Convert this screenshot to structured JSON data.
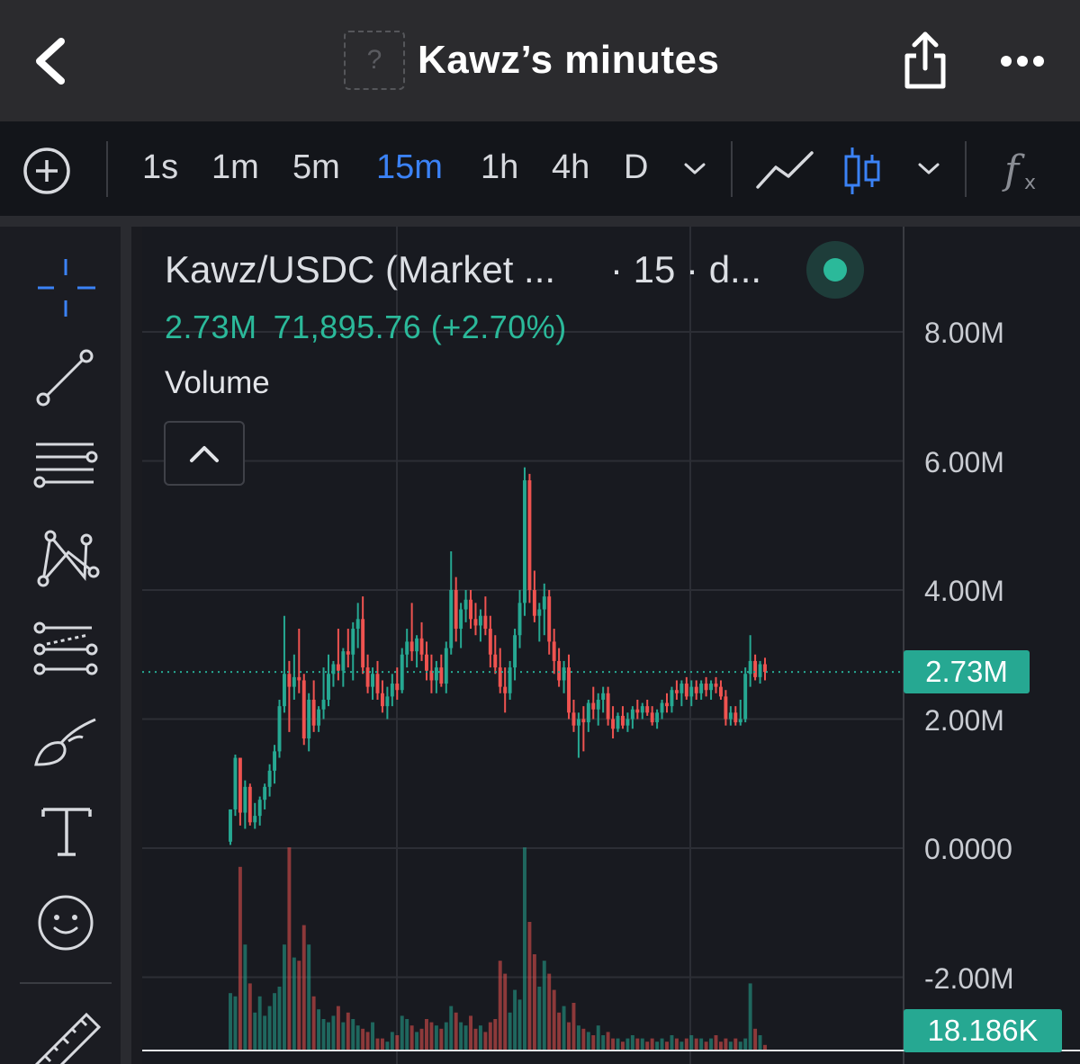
{
  "header": {
    "title": "Kawz’s minutes",
    "token_icon_glyph": "?",
    "back_icon": "chevron-left-icon",
    "share_icon": "share-icon",
    "more_icon": "more-horizontal-icon"
  },
  "toolbar": {
    "add_icon": "plus-circle-icon",
    "timeframes": [
      "1s",
      "1m",
      "5m",
      "15m",
      "1h",
      "4h",
      "D"
    ],
    "active_timeframe": "15m",
    "timeframe_dropdown_icon": "chevron-down-icon",
    "line_chart_icon": "line-chart-icon",
    "candle_chart_icon": "candlestick-icon",
    "chart_type_dropdown_icon": "chevron-down-icon",
    "indicators_icon": "function-icon"
  },
  "tools_rail": [
    "crosshair-icon",
    "trend-line-icon",
    "horizontal-lines-icon",
    "pattern-icon",
    "fib-tools-icon",
    "brush-icon",
    "text-icon",
    "emoji-icon",
    "ruler-icon"
  ],
  "legend": {
    "symbol": "Kawz/USDC (Market ...",
    "interval": "· 15 · d...",
    "status": "online",
    "last_value": "2.73M",
    "change": "71,895.76 (+2.70%)",
    "study_name": "Volume"
  },
  "price_axis": {
    "labels": [
      "8.00M",
      "6.00M",
      "4.00M",
      "2.00M",
      "0.0000",
      "-2.00M"
    ],
    "current_price_tag": "2.73M",
    "volume_tag": "18.186K"
  },
  "colors": {
    "up": "#26a892",
    "down": "#ef5350",
    "accent_blue": "#3b82f6",
    "background": "#181a20"
  },
  "chart_data": {
    "type": "candlestick",
    "interval": "15m",
    "y_unit": "market cap (USDC)",
    "ylim": [
      -2.6,
      9.0
    ],
    "last_price": 2.73,
    "series": [
      {
        "name": "Kawz/USDC (Market ...",
        "values": [
          [
            0.1,
            0.6,
            0.05,
            0.6
          ],
          [
            0.6,
            1.45,
            0.5,
            1.4
          ],
          [
            1.4,
            1.4,
            0.35,
            0.55
          ],
          [
            0.55,
            1.05,
            0.3,
            0.95
          ],
          [
            0.95,
            1.0,
            0.35,
            0.4
          ],
          [
            0.4,
            0.7,
            0.3,
            0.5
          ],
          [
            0.5,
            0.8,
            0.35,
            0.75
          ],
          [
            0.75,
            1.0,
            0.6,
            0.95
          ],
          [
            0.95,
            1.3,
            0.8,
            1.2
          ],
          [
            1.2,
            1.6,
            1.0,
            1.5
          ],
          [
            1.5,
            2.3,
            1.4,
            2.2
          ],
          [
            2.2,
            3.6,
            2.1,
            2.7
          ],
          [
            2.7,
            2.9,
            1.8,
            2.5
          ],
          [
            2.5,
            3.0,
            2.3,
            2.65
          ],
          [
            2.65,
            3.4,
            2.4,
            2.6
          ],
          [
            2.6,
            2.7,
            1.6,
            1.7
          ],
          [
            1.7,
            2.4,
            1.5,
            2.3
          ],
          [
            2.3,
            2.6,
            1.8,
            1.9
          ],
          [
            1.9,
            2.2,
            1.8,
            2.15
          ],
          [
            2.15,
            2.8,
            2.0,
            2.3
          ],
          [
            2.3,
            3.0,
            2.2,
            2.7
          ],
          [
            2.7,
            2.9,
            2.5,
            2.85
          ],
          [
            2.85,
            3.4,
            2.6,
            2.75
          ],
          [
            2.75,
            3.1,
            2.5,
            3.05
          ],
          [
            3.05,
            3.4,
            2.8,
            3.0
          ],
          [
            3.0,
            3.5,
            2.6,
            3.4
          ],
          [
            3.4,
            3.8,
            3.1,
            3.55
          ],
          [
            3.55,
            3.9,
            2.7,
            2.8
          ],
          [
            2.8,
            3.0,
            2.4,
            2.5
          ],
          [
            2.5,
            2.8,
            2.3,
            2.7
          ],
          [
            2.7,
            2.9,
            2.3,
            2.4
          ],
          [
            2.4,
            2.6,
            2.1,
            2.2
          ],
          [
            2.2,
            2.5,
            2.0,
            2.35
          ],
          [
            2.35,
            2.7,
            2.2,
            2.55
          ],
          [
            2.55,
            2.8,
            2.3,
            2.45
          ],
          [
            2.45,
            3.1,
            2.4,
            3.0
          ],
          [
            3.0,
            3.4,
            2.8,
            3.2
          ],
          [
            3.2,
            3.8,
            2.9,
            3.05
          ],
          [
            3.05,
            3.3,
            2.8,
            3.25
          ],
          [
            3.25,
            3.5,
            2.9,
            3.0
          ],
          [
            3.0,
            3.2,
            2.6,
            2.75
          ],
          [
            2.75,
            3.0,
            2.4,
            2.6
          ],
          [
            2.6,
            2.9,
            2.4,
            2.8
          ],
          [
            2.8,
            3.0,
            2.5,
            2.55
          ],
          [
            2.55,
            3.2,
            2.4,
            3.1
          ],
          [
            3.1,
            4.6,
            3.0,
            4.0
          ],
          [
            4.0,
            4.2,
            3.2,
            3.4
          ],
          [
            3.4,
            3.8,
            3.1,
            3.7
          ],
          [
            3.7,
            4.0,
            3.5,
            3.85
          ],
          [
            3.85,
            4.0,
            3.4,
            3.55
          ],
          [
            3.55,
            3.8,
            3.3,
            3.45
          ],
          [
            3.45,
            3.7,
            3.2,
            3.6
          ],
          [
            3.6,
            3.9,
            3.3,
            3.4
          ],
          [
            3.4,
            3.6,
            2.8,
            3.0
          ],
          [
            3.0,
            3.3,
            2.7,
            2.8
          ],
          [
            2.8,
            3.1,
            2.4,
            2.5
          ],
          [
            2.5,
            2.8,
            2.1,
            2.4
          ],
          [
            2.4,
            2.9,
            2.3,
            2.8
          ],
          [
            2.8,
            3.4,
            2.6,
            3.3
          ],
          [
            3.3,
            4.0,
            3.1,
            3.8
          ],
          [
            3.8,
            5.9,
            3.6,
            5.7
          ],
          [
            5.7,
            5.8,
            3.8,
            4.0
          ],
          [
            4.0,
            4.3,
            3.5,
            3.6
          ],
          [
            3.6,
            3.8,
            3.2,
            3.7
          ],
          [
            3.7,
            4.1,
            3.3,
            3.9
          ],
          [
            3.9,
            4.0,
            3.0,
            3.2
          ],
          [
            3.2,
            3.4,
            2.7,
            2.9
          ],
          [
            2.9,
            3.1,
            2.5,
            2.6
          ],
          [
            2.6,
            2.9,
            2.4,
            2.8
          ],
          [
            2.8,
            3.0,
            2.0,
            2.1
          ],
          [
            2.1,
            2.3,
            1.8,
            1.9
          ],
          [
            1.9,
            2.1,
            1.4,
            2.0
          ],
          [
            2.0,
            2.2,
            1.5,
            1.95
          ],
          [
            1.95,
            2.3,
            1.8,
            2.25
          ],
          [
            2.25,
            2.5,
            2.0,
            2.15
          ],
          [
            2.15,
            2.4,
            1.9,
            2.3
          ],
          [
            2.3,
            2.5,
            2.1,
            2.4
          ],
          [
            2.4,
            2.5,
            1.9,
            2.0
          ],
          [
            2.0,
            2.2,
            1.7,
            1.85
          ],
          [
            1.85,
            2.1,
            1.8,
            2.05
          ],
          [
            2.05,
            2.2,
            1.85,
            1.9
          ],
          [
            1.9,
            2.1,
            1.8,
            2.0
          ],
          [
            2.0,
            2.2,
            1.85,
            2.15
          ],
          [
            2.15,
            2.3,
            2.0,
            2.1
          ],
          [
            2.1,
            2.25,
            2.0,
            2.2
          ],
          [
            2.2,
            2.3,
            2.05,
            2.1
          ],
          [
            2.1,
            2.2,
            1.9,
            1.95
          ],
          [
            1.95,
            2.15,
            1.85,
            2.1
          ],
          [
            2.1,
            2.3,
            2.0,
            2.25
          ],
          [
            2.25,
            2.4,
            2.1,
            2.2
          ],
          [
            2.2,
            2.5,
            2.1,
            2.45
          ],
          [
            2.45,
            2.6,
            2.3,
            2.4
          ],
          [
            2.4,
            2.6,
            2.2,
            2.55
          ],
          [
            2.55,
            2.65,
            2.3,
            2.35
          ],
          [
            2.35,
            2.6,
            2.2,
            2.5
          ],
          [
            2.5,
            2.6,
            2.3,
            2.4
          ],
          [
            2.4,
            2.6,
            2.3,
            2.55
          ],
          [
            2.55,
            2.65,
            2.35,
            2.45
          ],
          [
            2.45,
            2.6,
            2.3,
            2.55
          ],
          [
            2.55,
            2.65,
            2.4,
            2.5
          ],
          [
            2.5,
            2.6,
            2.3,
            2.35
          ],
          [
            2.35,
            2.45,
            1.9,
            2.0
          ],
          [
            2.0,
            2.2,
            1.9,
            2.1
          ],
          [
            2.1,
            2.2,
            1.9,
            1.95
          ],
          [
            1.95,
            2.3,
            1.9,
            2.0
          ],
          [
            2.0,
            2.8,
            1.95,
            2.7
          ],
          [
            2.7,
            3.3,
            2.5,
            2.9
          ],
          [
            2.9,
            3.0,
            2.6,
            2.65
          ],
          [
            2.65,
            2.9,
            2.55,
            2.85
          ],
          [
            2.85,
            2.95,
            2.6,
            2.73
          ]
        ]
      }
    ],
    "volume": {
      "color_by_candle": true,
      "values": [
        0.9,
        0.85,
        2.85,
        1.65,
        1.05,
        0.6,
        0.85,
        0.55,
        0.7,
        0.9,
        1.0,
        1.65,
        3.15,
        1.45,
        1.4,
        1.95,
        1.65,
        0.85,
        0.65,
        0.5,
        0.45,
        0.55,
        0.7,
        0.45,
        0.6,
        0.5,
        0.4,
        0.35,
        0.3,
        0.45,
        0.2,
        0.2,
        0.15,
        0.3,
        0.25,
        0.55,
        0.5,
        0.4,
        0.3,
        0.35,
        0.5,
        0.45,
        0.4,
        0.35,
        0.45,
        0.7,
        0.6,
        0.45,
        0.4,
        0.55,
        0.35,
        0.4,
        0.3,
        0.45,
        0.5,
        1.4,
        1.2,
        0.6,
        0.95,
        0.8,
        3.15,
        2.0,
        1.5,
        1.0,
        1.4,
        1.2,
        0.95,
        0.6,
        0.7,
        0.45,
        0.75,
        0.4,
        0.35,
        0.3,
        0.25,
        0.4,
        0.25,
        0.3,
        0.2,
        0.2,
        0.15,
        0.2,
        0.25,
        0.2,
        0.2,
        0.15,
        0.2,
        0.15,
        0.2,
        0.15,
        0.25,
        0.2,
        0.15,
        0.2,
        0.25,
        0.2,
        0.2,
        0.15,
        0.2,
        0.25,
        0.15,
        0.2,
        0.15,
        0.2,
        0.15,
        0.2,
        1.05,
        0.35,
        0.25,
        0.1
      ]
    }
  }
}
